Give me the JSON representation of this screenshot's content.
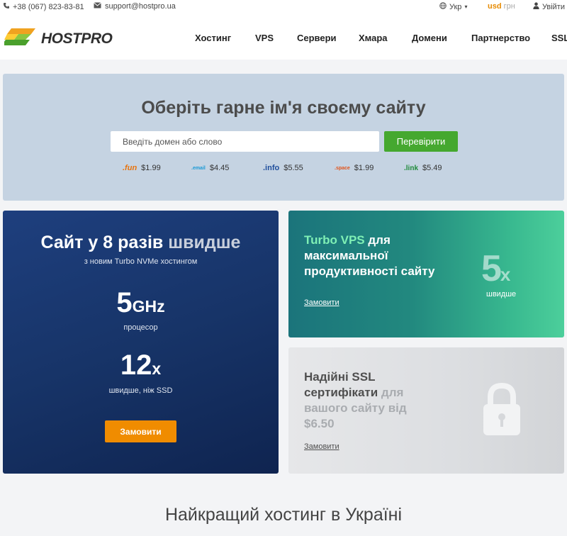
{
  "topbar": {
    "phone": "+38 (067) 823-83-81",
    "email": "support@hostpro.ua",
    "language": "Укр",
    "currency_active": "usd",
    "currency_inactive": "грн",
    "login": "Увійти"
  },
  "header": {
    "brand": "HOSTPRO",
    "nav": [
      "Хостинг",
      "VPS",
      "Сервери",
      "Хмара",
      "Домени",
      "Партнерство",
      "SSL"
    ]
  },
  "hero": {
    "title": "Оберіть гарне ім'я своєму сайту",
    "search_placeholder": "Введіть домен або слово",
    "check_button": "Перевірити",
    "tlds": [
      {
        "name": ".fun",
        "price": "$1.99",
        "color": "#e8730c"
      },
      {
        "name": ".email",
        "price": "$4.45",
        "color": "#1b9ad6"
      },
      {
        "name": ".info",
        "price": "$5.55",
        "color": "#1f4e9c"
      },
      {
        "name": ".space",
        "price": "$1.99",
        "color": "#e2541b"
      },
      {
        "name": ".link",
        "price": "$5.49",
        "color": "#1f8a3a"
      }
    ]
  },
  "card_speed": {
    "title_a": "Сайт у 8 разів",
    "title_b": "швидше",
    "subtitle": "з новим Turbo NVMe хостингом",
    "stat1_value": "5",
    "stat1_unit": "GHz",
    "stat1_caption": "процесор",
    "stat2_value": "12",
    "stat2_unit": "x",
    "stat2_caption": "швидше, ніж SSD",
    "button": "Замовити"
  },
  "card_vps": {
    "title_accent": "Turbo VPS",
    "title_rest": "для максимальної продуктивності сайту",
    "big_value": "5",
    "big_unit": "x",
    "big_caption": "швидше",
    "link": "Замовити"
  },
  "card_ssl": {
    "title_main": "Надійні SSL сертифікати",
    "title_fade": "для вашого сайту",
    "title_price": "від $6.50",
    "link": "Замовити"
  },
  "section_title": "Найкращий хостинг в Україні",
  "colors": {
    "accent_orange": "#f08c00",
    "accent_green": "#45a82f",
    "hero_bg": "#c5d3e2",
    "card_blue": "#173468"
  }
}
